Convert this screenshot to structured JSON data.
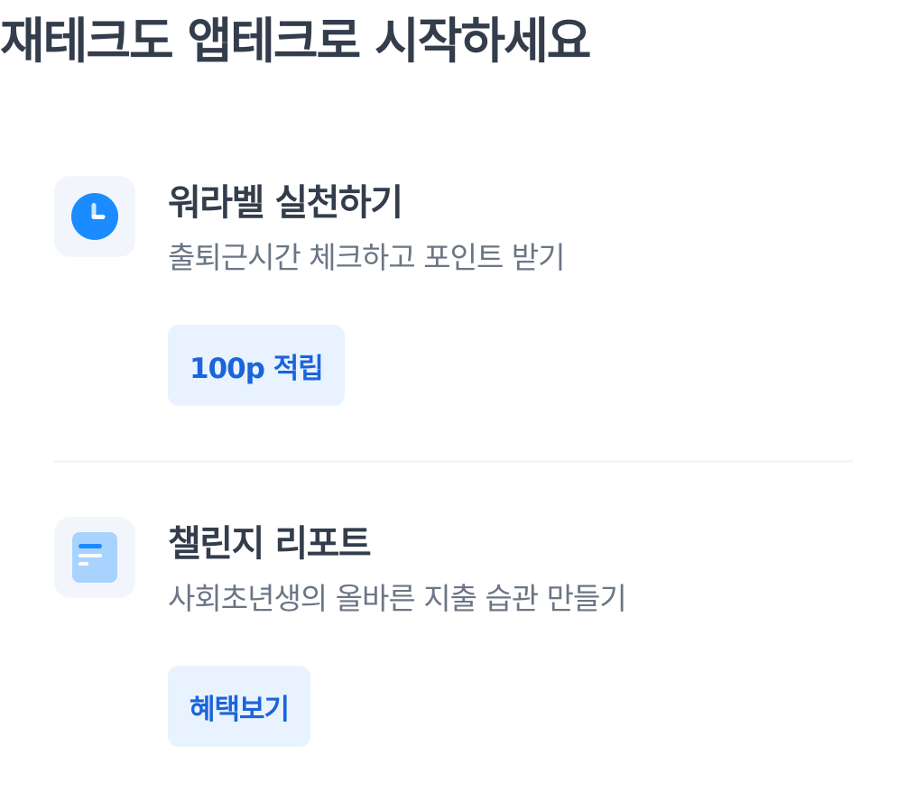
{
  "header": {
    "title": "재테크도 앱테크로 시작하세요"
  },
  "items": [
    {
      "icon": "clock-icon",
      "title": "워라벨 실천하기",
      "description": "출퇴근시간 체크하고 포인트 받기",
      "button_label": "100p 적립"
    },
    {
      "icon": "report-icon",
      "title": "챌린지 리포트",
      "description": "사회초년생의 올바른 지출 습관 만들기",
      "button_label": "혜택보기"
    }
  ],
  "colors": {
    "accent": "#1b64da",
    "accent_light": "#e8f3ff",
    "icon_blue": "#3182f6",
    "icon_bg": "#f2f6fc",
    "text_primary": "#333d4b",
    "text_secondary": "#6b7684"
  }
}
